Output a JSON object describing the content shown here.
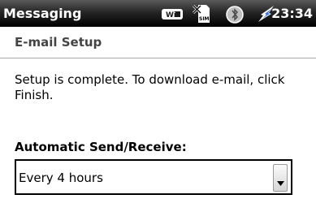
{
  "statusbar": {
    "app_name": "Messaging",
    "time": "23:34",
    "icons": [
      "wifi-icon",
      "no-sim-icon",
      "bluetooth-icon",
      "battery-charging-icon"
    ],
    "wifi_label": "Wi",
    "sim_label": "SIM"
  },
  "page": {
    "title": "E-mail Setup",
    "message": "Setup is complete.  To download e-mail, click Finish."
  },
  "auto_send_receive": {
    "label": "Automatic Send/Receive:",
    "selected_value": "Every 4 hours"
  },
  "colors": {
    "statusbar_bg": "#000000",
    "title_text": "#444444",
    "divider": "#a8a8a8"
  }
}
